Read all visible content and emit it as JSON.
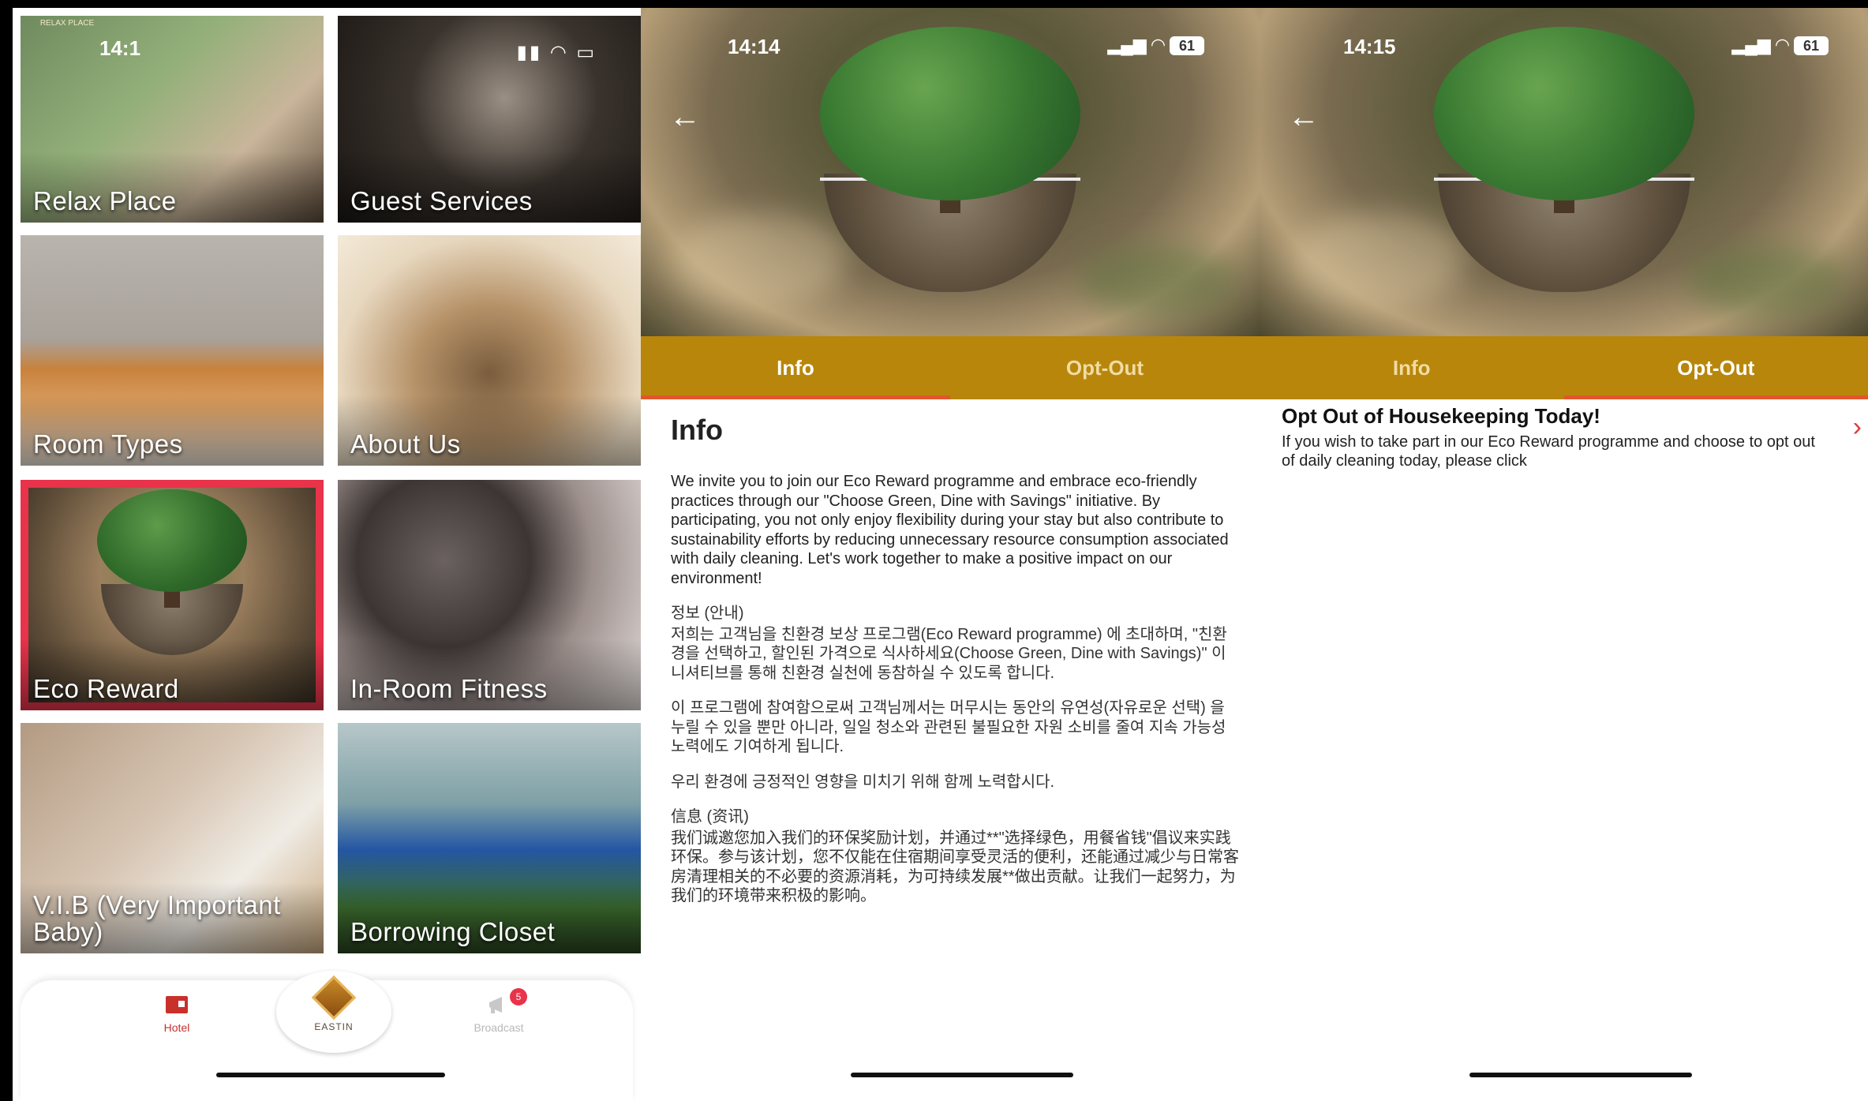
{
  "screen1": {
    "relax_logo": "RELAX PLACE",
    "status_time_partial": "14:1",
    "tiles": [
      {
        "label": "Relax Place"
      },
      {
        "label": "Guest Services"
      },
      {
        "label": "Room Types"
      },
      {
        "label": "About Us"
      },
      {
        "label": "Eco Reward",
        "selected": true
      },
      {
        "label": "In-Room Fitness"
      },
      {
        "label": "V.I.B (Very Important Baby)"
      },
      {
        "label": "Borrowing Closet"
      }
    ],
    "tabbar": {
      "hotel_label": "Hotel",
      "center_label": "EASTIN",
      "broadcast_label": "Broadcast",
      "broadcast_badge": "5"
    },
    "accent_color": "#e8334a"
  },
  "screen2": {
    "status_time": "14:14",
    "battery": "61",
    "tabs": {
      "info": "Info",
      "optout": "Opt-Out"
    },
    "active_tab": "info",
    "title": "Info",
    "en_paragraph": "We invite you to join our Eco Reward programme and embrace eco-friendly practices through our \"Choose Green, Dine with Savings\" initiative. By participating, you not only enjoy flexibility during your stay but also contribute to sustainability efforts by reducing unnecessary resource consumption associated with daily cleaning. Let's work together to make a positive impact on our environment!",
    "ko_heading": "정보 (안내)",
    "ko_paragraph1": "저희는 고객님을 친환경 보상 프로그램(Eco Reward programme) 에 초대하며, \"친환경을 선택하고, 할인된 가격으로 식사하세요(Choose Green, Dine with Savings)\" 이니셔티브를 통해 친환경 실천에 동참하실 수 있도록 합니다.",
    "ko_paragraph2": "이 프로그램에 참여함으로써 고객님께서는 머무시는 동안의 유연성(자유로운 선택) 을 누릴 수 있을 뿐만 아니라, 일일 청소와 관련된 불필요한 자원 소비를 줄여 지속 가능성 노력에도 기여하게 됩니다.",
    "ko_paragraph3": "우리 환경에 긍정적인 영향을 미치기 위해 함께 노력합시다.",
    "zh_heading": "信息 (资讯)",
    "zh_paragraph": "我们诚邀您加入我们的环保奖励计划，并通过**\"选择绿色，用餐省钱\"倡议来实践环保。参与该计划，您不仅能在住宿期间享受灵活的便利，还能通过减少与日常客房清理相关的不必要的资源消耗，为可持续发展**做出贡献。让我们一起努力，为我们的环境带来积极的影响。",
    "tab_color": "#b8860b",
    "tab_indicator_color": "#e0572d"
  },
  "screen3": {
    "status_time": "14:15",
    "battery": "61",
    "tabs": {
      "info": "Info",
      "optout": "Opt-Out"
    },
    "active_tab": "optout",
    "optout_title": "Opt Out of Housekeeping Today!",
    "optout_text": "If you wish to take part in our Eco Reward programme and choose to opt out of daily cleaning today, please click"
  }
}
